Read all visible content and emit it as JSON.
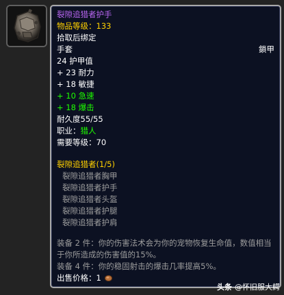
{
  "item": {
    "icon": "leather-glove-icon",
    "name": "裂隙追猎者护手",
    "item_level": "物品等级：133",
    "binding": "拾取后绑定",
    "slot": "手套",
    "armor_type": "鎖甲",
    "armor": "24 护甲值",
    "stats": [
      "+ 23 耐力",
      "+ 18 敏捷",
      "+ 10 急速",
      "+ 18 爆击"
    ],
    "durability": "耐久度55/55",
    "class_label": "职业：",
    "class_value": "猎人",
    "required_level": "需要等级：70"
  },
  "set": {
    "name": "裂隙追猎者",
    "count": "(1/5)",
    "pieces": [
      "裂隙追猎者胸甲",
      "裂隙追猎者护手",
      "裂隙追猎者头盔",
      "裂隙追猎者护腿",
      "裂隙追猎者护肩"
    ],
    "bonus_2": "装备 2 件：你的伤害法术会为你的宠物恢复生命值，数值相当于你所造成的伤害值的15%。",
    "bonus_4": "装备 4 件：你的稳固射击的爆击几率提高5%。"
  },
  "sell_price": {
    "label": "出售价格：",
    "amount": "1",
    "coin": "copper-coin-icon"
  },
  "watermark": {
    "brand": "头条",
    "account": "@怀旧服大鳄"
  },
  "colors": {
    "epic": "#b765f0",
    "item_level": "#ffd100",
    "green_stat": "#1eff00",
    "inactive": "#9d9d9d",
    "tooltip_bg": "#0c1122",
    "tooltip_border": "#a9a9a9"
  }
}
